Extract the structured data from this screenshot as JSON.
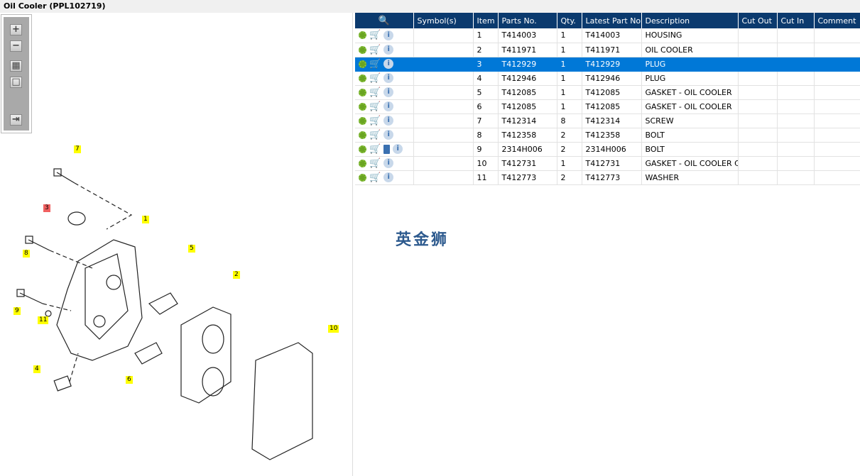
{
  "title": "Oil Cooler (PPL102719)",
  "toolbar": {
    "zoom_in": "+",
    "zoom_out": "−",
    "fit": "▦",
    "single": "□",
    "list": "⇥"
  },
  "callouts": [
    {
      "label": "7",
      "red": false
    },
    {
      "label": "3",
      "red": true
    },
    {
      "label": "1",
      "red": false
    },
    {
      "label": "8",
      "red": false
    },
    {
      "label": "5",
      "red": false
    },
    {
      "label": "2",
      "red": false
    },
    {
      "label": "9",
      "red": false
    },
    {
      "label": "11",
      "red": false
    },
    {
      "label": "10",
      "red": false
    },
    {
      "label": "4",
      "red": false
    },
    {
      "label": "6",
      "red": false
    }
  ],
  "table": {
    "headers": [
      "",
      "Symbol(s)",
      "Item",
      "Parts No.",
      "Qty.",
      "Latest Part No.",
      "Description",
      "Cut Out",
      "Cut In",
      "Comment"
    ],
    "selected_item": "3",
    "rows": [
      {
        "item": "1",
        "part": "T414003",
        "qty": "1",
        "latest": "T414003",
        "desc": "HOUSING",
        "book": false
      },
      {
        "item": "2",
        "part": "T411971",
        "qty": "1",
        "latest": "T411971",
        "desc": "OIL COOLER",
        "book": false
      },
      {
        "item": "3",
        "part": "T412929",
        "qty": "1",
        "latest": "T412929",
        "desc": "PLUG",
        "book": false
      },
      {
        "item": "4",
        "part": "T412946",
        "qty": "1",
        "latest": "T412946",
        "desc": "PLUG",
        "book": false
      },
      {
        "item": "5",
        "part": "T412085",
        "qty": "1",
        "latest": "T412085",
        "desc": "GASKET - OIL COOLER",
        "book": false
      },
      {
        "item": "6",
        "part": "T412085",
        "qty": "1",
        "latest": "T412085",
        "desc": "GASKET - OIL COOLER",
        "book": false
      },
      {
        "item": "7",
        "part": "T412314",
        "qty": "8",
        "latest": "T412314",
        "desc": "SCREW",
        "book": false
      },
      {
        "item": "8",
        "part": "T412358",
        "qty": "2",
        "latest": "T412358",
        "desc": "BOLT",
        "book": false
      },
      {
        "item": "9",
        "part": "2314H006",
        "qty": "2",
        "latest": "2314H006",
        "desc": "BOLT",
        "book": true
      },
      {
        "item": "10",
        "part": "T412731",
        "qty": "1",
        "latest": "T412731",
        "desc": "GASKET - OIL COOLER CO",
        "book": false
      },
      {
        "item": "11",
        "part": "T412773",
        "qty": "2",
        "latest": "T412773",
        "desc": "WASHER",
        "book": false
      }
    ]
  },
  "watermark": "英金狮"
}
